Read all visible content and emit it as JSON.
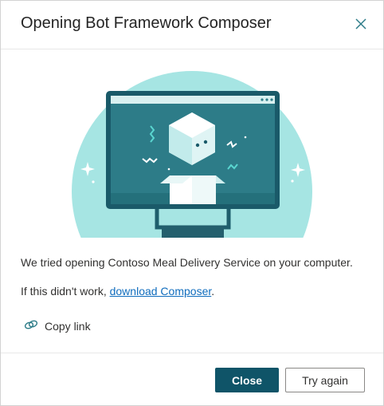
{
  "dialog": {
    "title": "Opening Bot Framework Composer",
    "close_icon": "close-icon"
  },
  "illustration": {
    "icon": "monitor-box-illustration",
    "colors": {
      "circle": "#a6e5e3",
      "monitor": "#1a5a69",
      "screen": "#2d7c88",
      "accent": "#5ad6d0"
    }
  },
  "body": {
    "message": "We tried opening Contoso Meal Delivery Service on your computer.",
    "fallback_prefix": "If this didn't work, ",
    "fallback_link": "download Composer",
    "fallback_suffix": "."
  },
  "copy_link": {
    "icon": "link-icon",
    "label": "Copy link"
  },
  "footer": {
    "close_label": "Close",
    "retry_label": "Try again"
  },
  "colors": {
    "primary": "#0f5468",
    "link": "#0f6cbd"
  }
}
